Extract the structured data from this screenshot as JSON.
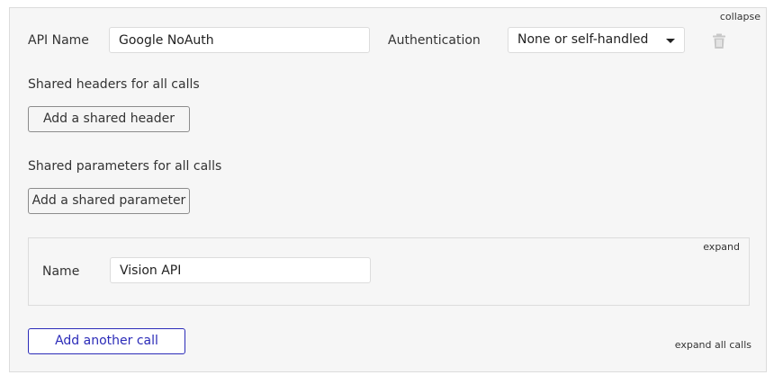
{
  "api": {
    "collapse_label": "collapse",
    "name_label": "API Name",
    "name_value": "Google NoAuth",
    "auth_label": "Authentication",
    "auth_selected": "None or self-handled",
    "delete_icon": "trash-icon"
  },
  "shared_headers": {
    "heading": "Shared headers for all calls",
    "add_button": "Add a shared header"
  },
  "shared_params": {
    "heading": "Shared parameters for all calls",
    "add_button": "Add a shared parameter"
  },
  "call": {
    "expand_label": "expand",
    "name_label": "Name",
    "name_value": "Vision API"
  },
  "footer": {
    "add_call_button": "Add another call",
    "expand_all_label": "expand all calls"
  },
  "colors": {
    "primary_border": "#2b2bb8",
    "panel_bg": "#f6f6f6",
    "border": "#dcdcdc",
    "trash_icon": "#c8c8c8"
  }
}
